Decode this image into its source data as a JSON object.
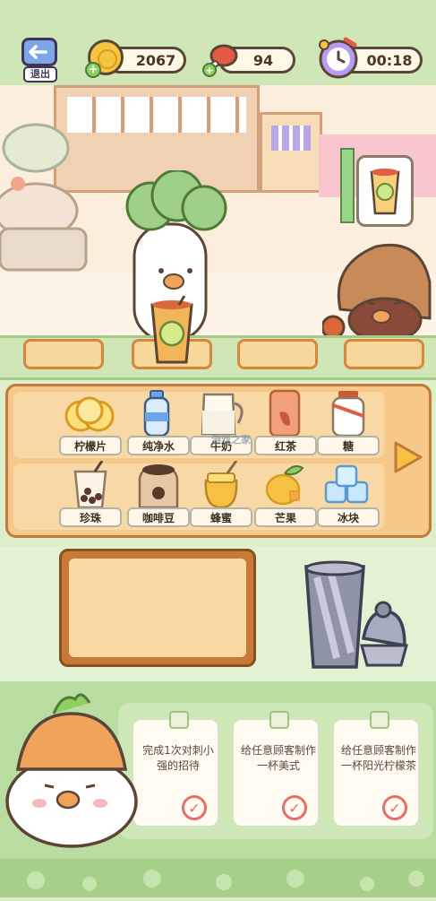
{
  "hud": {
    "exit_label": "退出",
    "coins": "2067",
    "meat": "94",
    "timer": "00:18"
  },
  "icons": {
    "exit": "door-exit-icon",
    "coin": "coin-icon",
    "meat": "meat-icon",
    "clock": "alarm-clock-icon",
    "next": "right-arrow-icon",
    "check": "check-circle-icon"
  },
  "ingredients": {
    "row1": [
      {
        "label": "柠檬片",
        "icon": "lemon-slices-icon"
      },
      {
        "label": "纯净水",
        "icon": "water-bottle-icon"
      },
      {
        "label": "牛奶",
        "icon": "milk-jug-icon"
      },
      {
        "label": "红茶",
        "icon": "black-tea-icon"
      },
      {
        "label": "糖",
        "icon": "sugar-jar-icon"
      }
    ],
    "row2": [
      {
        "label": "珍珠",
        "icon": "pearls-cup-icon"
      },
      {
        "label": "咖啡豆",
        "icon": "coffee-beans-icon"
      },
      {
        "label": "蜂蜜",
        "icon": "honey-jar-icon"
      },
      {
        "label": "芒果",
        "icon": "mango-icon"
      },
      {
        "label": "冰块",
        "icon": "ice-cubes-icon"
      }
    ]
  },
  "watermark": "游戏之家",
  "tasks": [
    {
      "text": "完成1次对刺小强的招待"
    },
    {
      "text": "给任意顾客制作一杯美式"
    },
    {
      "text": "给任意顾客制作一杯阳光柠檬茶"
    }
  ],
  "colors": {
    "background": "#dcefc9",
    "panel": "#f6c98a",
    "panel_border": "#c07a3a",
    "outline": "#5a4536",
    "accent_green": "#8fcf62"
  }
}
